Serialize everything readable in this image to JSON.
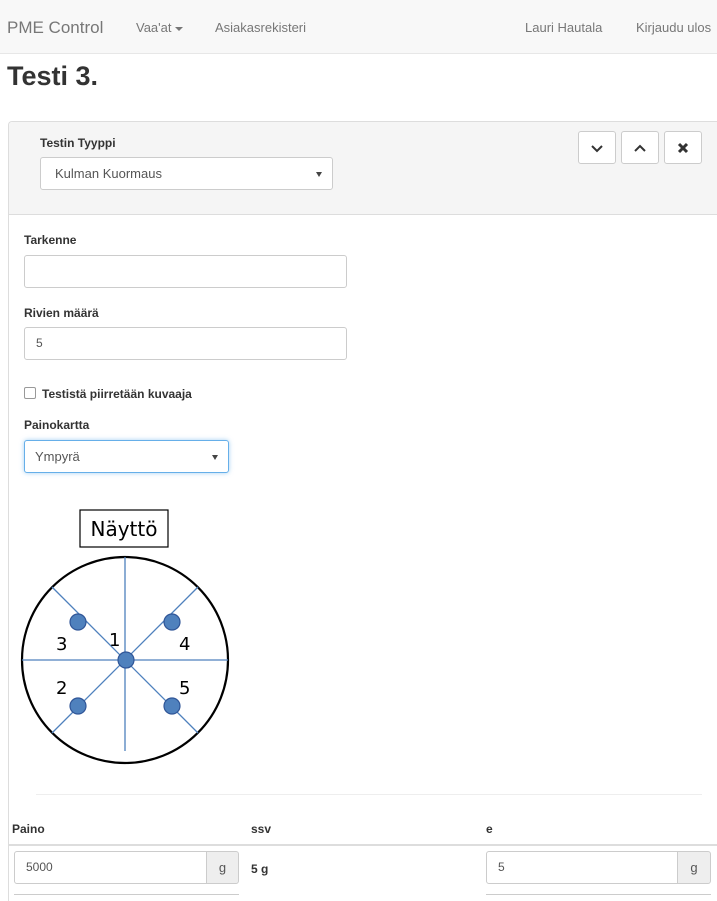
{
  "navbar": {
    "brand": "PME Control",
    "menu_scales": "Vaa'at",
    "menu_customers": "Asiakasrekisteri",
    "user": "Lauri Hautala",
    "logout": "Kirjaudu ulos"
  },
  "page": {
    "title": "Testi 3."
  },
  "test_panel": {
    "type_label": "Testin Tyyppi",
    "type_value": "Kulman Kuormaus",
    "buttons": {
      "down_icon": "chevron-down-icon",
      "up_icon": "chevron-up-icon",
      "remove_icon": "close-icon"
    }
  },
  "form": {
    "refinement_label": "Tarkenne",
    "refinement_value": "",
    "rows_label": "Rivien määrä",
    "rows_value": "5",
    "chart_checkbox_label": "Testistä piirretään kuvaaja",
    "chart_checkbox_checked": false,
    "weight_map_label": "Painokartta",
    "weight_map_value": "Ympyrä"
  },
  "diagram": {
    "screen_label": "Näyttö",
    "positions": [
      "1",
      "2",
      "3",
      "4",
      "5"
    ]
  },
  "table": {
    "headers": {
      "weight": "Paino",
      "ssv": "ssv",
      "e": "e"
    },
    "rows": [
      {
        "weight": "5000",
        "weight_unit": "g",
        "ssv": "5 g",
        "e": "5",
        "e_unit": "g"
      }
    ]
  },
  "colors": {
    "navbar_bg": "#f8f8f8",
    "panel_heading_bg": "#f5f5f5",
    "marker_fill": "#4f81bd",
    "diagram_lines": "#4f81bd"
  }
}
